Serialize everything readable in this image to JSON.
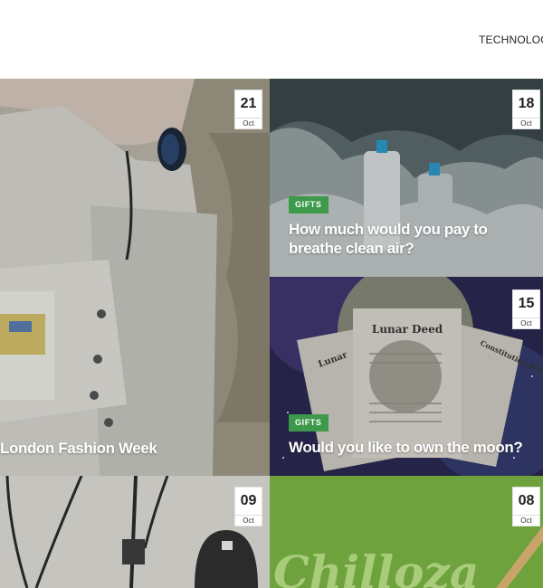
{
  "nav": {
    "label": "TECHNOLOGY"
  },
  "cards": [
    {
      "day": "21",
      "month": "Oct",
      "tag": "",
      "title": "London Fashion Week"
    },
    {
      "day": "18",
      "month": "Oct",
      "tag": "GIFTS",
      "title": "How much would you pay to breathe clean air?"
    },
    {
      "day": "15",
      "month": "Oct",
      "tag": "GIFTS",
      "title": "Would you like to own the moon?"
    },
    {
      "day": "09",
      "month": "Oct",
      "tag": "",
      "title": ""
    },
    {
      "day": "08",
      "month": "Oct",
      "tag": "",
      "title": ""
    }
  ],
  "images": {
    "deed_titles": [
      "Lunar",
      "Lunar Deed",
      "Constitution Bill Rights"
    ],
    "logo_text": "Chilloza"
  },
  "colors": {
    "tag_green": "#3c9a4a",
    "card5_bg": "#6da23d"
  }
}
